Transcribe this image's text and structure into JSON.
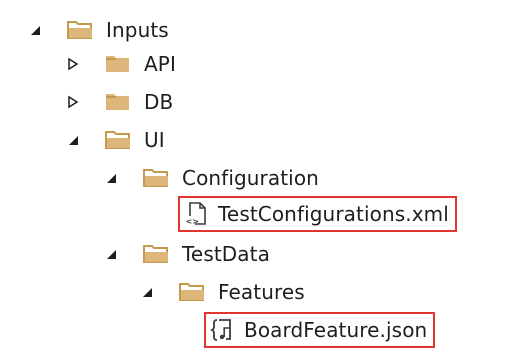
{
  "tree": {
    "inputs": {
      "label": "Inputs",
      "expanded": true,
      "icon": "folder-open-icon"
    },
    "api": {
      "label": "API",
      "expanded": false,
      "icon": "folder-closed-icon"
    },
    "db": {
      "label": "DB",
      "expanded": false,
      "icon": "folder-closed-icon"
    },
    "ui": {
      "label": "UI",
      "expanded": true,
      "icon": "folder-open-icon"
    },
    "configuration": {
      "label": "Configuration",
      "expanded": true,
      "icon": "folder-open-icon"
    },
    "test_configurations": {
      "label": "TestConfigurations.xml",
      "icon": "xml-file-icon",
      "highlighted": true
    },
    "testdata": {
      "label": "TestData",
      "expanded": true,
      "icon": "folder-open-icon"
    },
    "features": {
      "label": "Features",
      "expanded": true,
      "icon": "folder-open-icon"
    },
    "board_feature": {
      "label": "BoardFeature.json",
      "icon": "json-file-icon",
      "highlighted": true
    }
  },
  "colors": {
    "folder": "#dcb67a",
    "folder_dark": "#c59a4f",
    "highlight_border": "#e0342f",
    "text": "#1e1e1e",
    "arrow": "#1e1e1e"
  }
}
